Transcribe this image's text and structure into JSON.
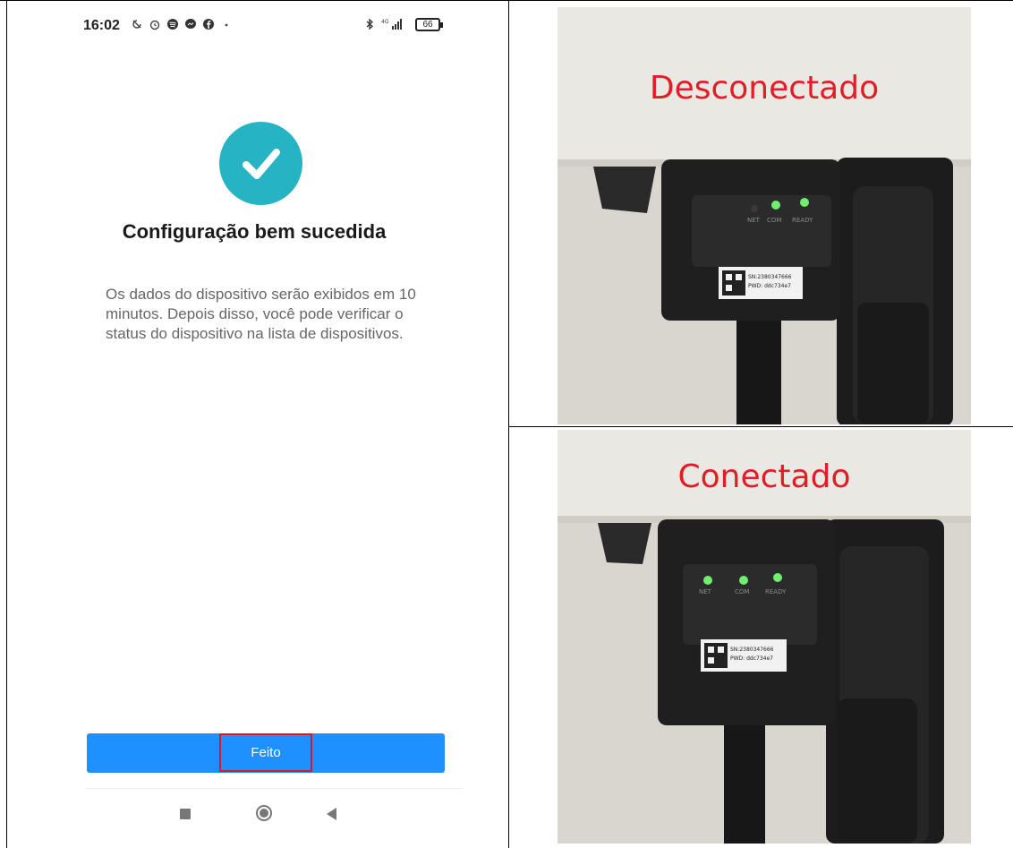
{
  "phone": {
    "status_time": "16:02",
    "battery_level": "66",
    "success_title": "Configuração bem sucedida",
    "success_description": "Os dados do dispositivo serão exibidos em 10 minutos. Depois disso, você pode verificar o status do dispositivo na lista de dispositivos.",
    "done_button_label": "Feito",
    "accent_color": "#26b3c4",
    "button_color": "#1e90ff",
    "highlight_color": "#d11a2a"
  },
  "photos": {
    "top": {
      "caption": "Desconectado",
      "led_labels": [
        "NET",
        "COM",
        "READY"
      ],
      "leds_lit": [
        false,
        true,
        true
      ],
      "sn_line": "SN:2380347666",
      "pwd_line": "PWD: ddc734e7"
    },
    "bottom": {
      "caption": "Conectado",
      "led_labels": [
        "NET",
        "COM",
        "READY"
      ],
      "leds_lit": [
        true,
        true,
        true
      ],
      "sn_line": "SN:2380347666",
      "pwd_line": "PWD: ddc734e7"
    },
    "caption_color": "#e01e25"
  }
}
